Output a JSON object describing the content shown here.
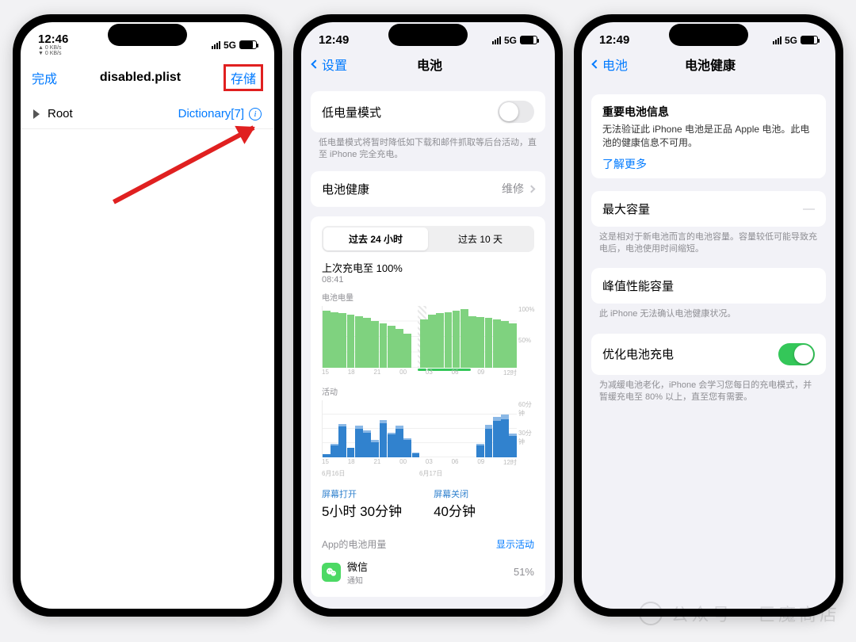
{
  "phone1": {
    "status": {
      "time": "12:46",
      "net_up": "▲ 0 KB/s",
      "net_down": "▼ 0 KB/s",
      "carrier": "5G"
    },
    "nav": {
      "back": "完成",
      "title": "disabled.plist",
      "action": "存储"
    },
    "row": {
      "key": "Root",
      "type": "Dictionary[7]"
    }
  },
  "phone2": {
    "status": {
      "time": "12:49",
      "carrier": "5G"
    },
    "nav": {
      "back": "设置",
      "title": "电池"
    },
    "lowpower": {
      "label": "低电量模式",
      "note": "低电量模式将暂时降低如下载和邮件抓取等后台活动，直至 iPhone 完全充电。"
    },
    "health": {
      "label": "电池健康",
      "value": "维修"
    },
    "segments": [
      "过去 24 小时",
      "过去 10 天"
    ],
    "last_charge": {
      "label": "上次充电至 100%",
      "time": "08:41"
    },
    "level_label": "电池电量",
    "activity_label": "活动",
    "screen_on": {
      "label": "屏幕打开",
      "value": "5小时 30分钟"
    },
    "screen_off": {
      "label": "屏幕关闭",
      "value": "40分钟"
    },
    "app_usage": {
      "header": "App的电池用量",
      "toggle": "显示活动",
      "apps": [
        {
          "name": "微信",
          "sub": "通知",
          "pct": "51%"
        }
      ]
    },
    "chart_ticks_y1": [
      "100%",
      "50%",
      ""
    ],
    "chart_ticks_y2": [
      "60分钟",
      "30分钟",
      ""
    ],
    "chart_ticks_x": [
      "15",
      "18",
      "21",
      "00",
      "03",
      "06",
      "09",
      "12时"
    ],
    "chart_dates": [
      "6月16日",
      "6月17日"
    ]
  },
  "phone3": {
    "status": {
      "time": "12:49",
      "carrier": "5G"
    },
    "nav": {
      "back": "电池",
      "title": "电池健康"
    },
    "important": {
      "title": "重要电池信息",
      "body": "无法验证此 iPhone 电池是正品 Apple 电池。此电池的健康信息不可用。",
      "link": "了解更多"
    },
    "max_cap": {
      "label": "最大容量",
      "value": "—",
      "note": "这是相对于新电池而言的电池容量。容量较低可能导致充电后，电池使用时间缩短。"
    },
    "peak": {
      "label": "峰值性能容量",
      "note": "此 iPhone 无法确认电池健康状况。"
    },
    "optimize": {
      "label": "优化电池充电",
      "note": "为减缓电池老化，iPhone 会学习您每日的充电模式，并暂缓充电至 80% 以上，直至您有需要。"
    }
  },
  "chart_data": [
    {
      "type": "bar",
      "title": "电池电量",
      "ylabel": "%",
      "ylim": [
        0,
        100
      ],
      "x": [
        "13",
        "14",
        "15",
        "16",
        "17",
        "18",
        "19",
        "20",
        "21",
        "22",
        "23",
        "00",
        "01",
        "02",
        "03",
        "04",
        "05",
        "06",
        "07",
        "08",
        "09",
        "10",
        "11",
        "12"
      ],
      "values": [
        92,
        90,
        88,
        86,
        83,
        80,
        76,
        72,
        68,
        62,
        55,
        0,
        78,
        85,
        88,
        90,
        92,
        95,
        83,
        82,
        80,
        78,
        75,
        72
      ],
      "charging_windows": [
        [
          11,
          12
        ],
        [
          12,
          17
        ]
      ],
      "hatched_windows": [
        [
          11,
          12
        ]
      ]
    },
    {
      "type": "bar",
      "title": "活动",
      "ylabel": "分钟",
      "ylim": [
        0,
        60
      ],
      "x": [
        "13",
        "14",
        "15",
        "16",
        "17",
        "18",
        "19",
        "20",
        "21",
        "22",
        "23",
        "00",
        "01",
        "02",
        "03",
        "04",
        "05",
        "06",
        "07",
        "08",
        "09",
        "10",
        "11",
        "12"
      ],
      "series": [
        {
          "name": "屏幕打开",
          "values": [
            3,
            12,
            32,
            10,
            30,
            26,
            16,
            36,
            24,
            30,
            18,
            4,
            0,
            0,
            0,
            0,
            0,
            0,
            0,
            12,
            30,
            38,
            40,
            22
          ]
        },
        {
          "name": "屏幕关闭",
          "values": [
            0,
            2,
            3,
            0,
            3,
            2,
            2,
            3,
            2,
            3,
            2,
            1,
            0,
            0,
            0,
            0,
            0,
            0,
            0,
            2,
            4,
            4,
            5,
            3
          ]
        }
      ]
    }
  ],
  "watermark": "公众号 · 巨魔商店"
}
